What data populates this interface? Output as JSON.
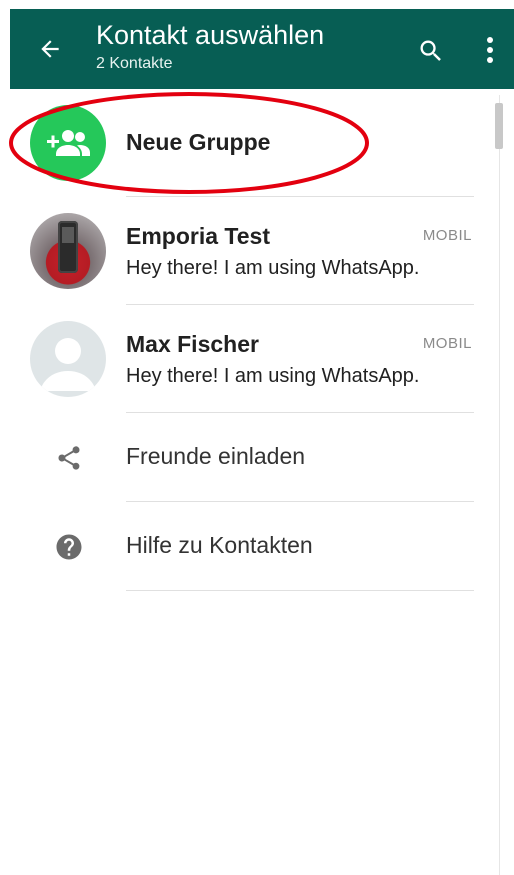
{
  "appbar": {
    "title": "Kontakt auswählen",
    "subtitle": "2 Kontakte",
    "back_icon": "arrow-left-icon",
    "search_icon": "search-icon",
    "menu_icon": "more-vert-icon"
  },
  "new_group": {
    "label": "Neue Gruppe",
    "icon": "group-add-icon"
  },
  "contacts": [
    {
      "name": "Emporia Test",
      "type": "MOBIL",
      "status": "Hey there! I am using WhatsApp."
    },
    {
      "name": "Max Fischer",
      "type": "MOBIL",
      "status": "Hey there! I am using WhatsApp."
    }
  ],
  "actions": [
    {
      "label": "Freunde einladen",
      "icon": "share-icon"
    },
    {
      "label": "Hilfe zu Kontakten",
      "icon": "help-icon"
    }
  ],
  "colors": {
    "appbar": "#075e54",
    "group_avatar": "#25c85a",
    "annotation": "#e3000f"
  }
}
